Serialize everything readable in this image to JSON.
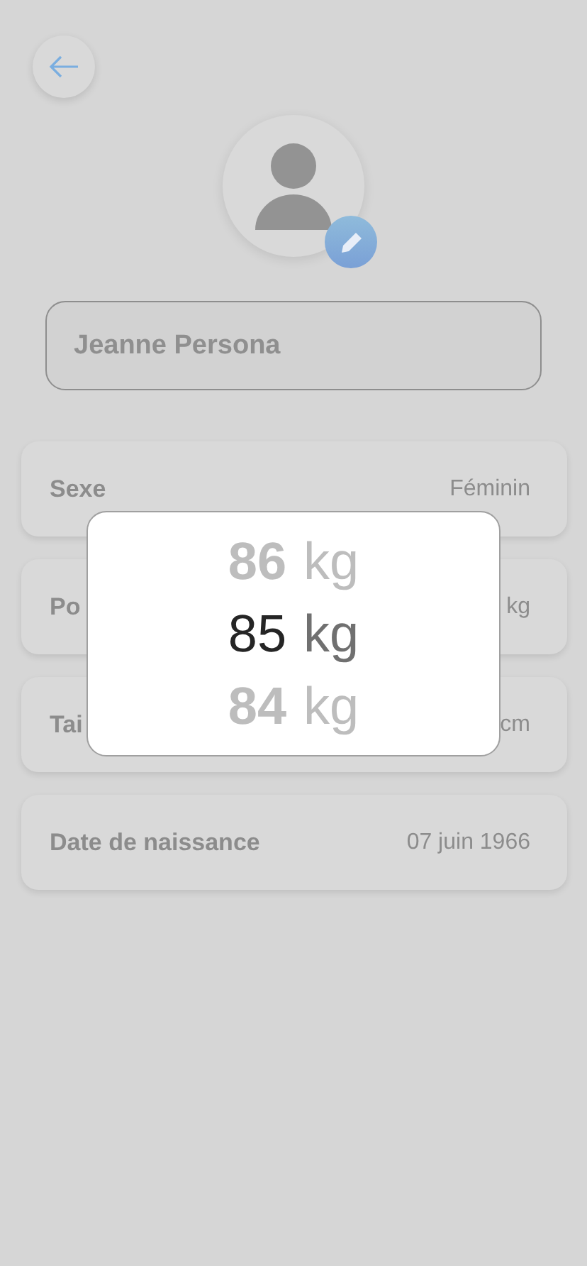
{
  "profile": {
    "name_field": {
      "value": "Jeanne Persona"
    }
  },
  "fields": [
    {
      "label": "Sexe",
      "value": "Féminin"
    },
    {
      "label": "Po",
      "value": "kg"
    },
    {
      "label": "Tai",
      "value": "cm"
    },
    {
      "label": "Date de naissance",
      "value": "07 juin 1966"
    }
  ],
  "picker": {
    "options": [
      {
        "number": "86",
        "unit": "kg",
        "selected": false
      },
      {
        "number": "85",
        "unit": "kg",
        "selected": true
      },
      {
        "number": "84",
        "unit": "kg",
        "selected": false
      }
    ]
  }
}
